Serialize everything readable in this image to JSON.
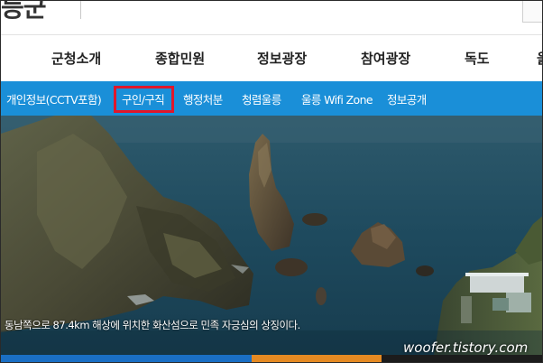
{
  "header": {
    "logo_text": "등군"
  },
  "main_nav": {
    "items": [
      {
        "label": "군청소개"
      },
      {
        "label": "종합민원"
      },
      {
        "label": "정보광장"
      },
      {
        "label": "참여광장"
      },
      {
        "label": "독도"
      },
      {
        "label": "울"
      }
    ],
    "active_index": 2
  },
  "sub_nav": {
    "items": [
      {
        "label": "개인정보(CCTV포함)"
      },
      {
        "label": "구인/구직"
      },
      {
        "label": "행정처분"
      },
      {
        "label": "청렴울릉"
      },
      {
        "label": "울릉 Wifi Zone"
      },
      {
        "label": "정보공개"
      }
    ],
    "highlighted_index": 1
  },
  "hero": {
    "caption": "동남쪽으로 87.4km 해상에 위치한 화산섬으로 민족 자긍심의 상징이다.",
    "watermark": "woofer.tistory.com"
  },
  "colors": {
    "subnav_bg": "#1a8fd8",
    "highlight_border": "#e0172b",
    "stripe_blue": "#1a6fc4",
    "stripe_orange": "#e58a22",
    "stripe_dark": "#1c1c1c"
  }
}
